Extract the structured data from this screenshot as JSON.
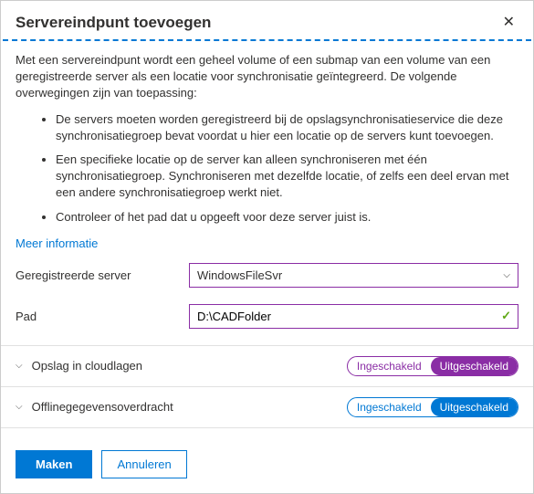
{
  "header": {
    "title": "Servereindpunt toevoegen"
  },
  "description": "Met een servereindpunt wordt een geheel volume of een submap van een volume van een geregistreerde server als een locatie voor synchronisatie geïntegreerd. De volgende overwegingen zijn van toepassing:",
  "bullets": [
    "De servers moeten worden geregistreerd bij de opslagsynchronisatieservice die deze synchronisatiegroep bevat voordat u hier een locatie op de servers kunt toevoegen.",
    "Een specifieke locatie op de server kan alleen synchroniseren met één synchronisatiegroep. Synchroniseren met dezelfde locatie, of zelfs een deel ervan met een andere synchronisatiegroep werkt niet.",
    "Controleer of het pad dat u opgeeft voor deze server juist is."
  ],
  "link": "Meer informatie",
  "form": {
    "server_label": "Geregistreerde server",
    "server_value": "WindowsFileSvr",
    "path_label": "Pad",
    "path_value": "D:\\CADFolder"
  },
  "sections": {
    "cloud": {
      "label": "Opslag in cloudlagen",
      "on": "Ingeschakeld",
      "off": "Uitgeschakeld"
    },
    "offline": {
      "label": "Offlinegegevensoverdracht",
      "on": "Ingeschakeld",
      "off": "Uitgeschakeld"
    }
  },
  "footer": {
    "create": "Maken",
    "cancel": "Annuleren"
  }
}
